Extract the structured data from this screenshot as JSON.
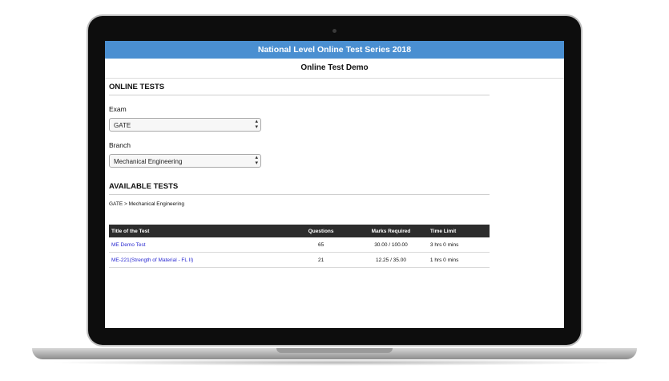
{
  "header": {
    "title": "National Level Online Test Series 2018"
  },
  "subheader": {
    "title": "Online Test Demo"
  },
  "online_tests": {
    "heading": "ONLINE TESTS",
    "exam_label": "Exam",
    "exam_value": "GATE",
    "branch_label": "Branch",
    "branch_value": "Mechanical Engineering"
  },
  "available_tests": {
    "heading": "AVAILABLE TESTS",
    "breadcrumb": "GATE > Mechanical Engineering",
    "columns": [
      "Title of the Test",
      "Questions",
      "Marks Required",
      "Time Limit"
    ],
    "rows": [
      {
        "title": "ME Demo Test",
        "questions": "65",
        "marks": "30.00 / 100.00",
        "time": "3 hrs 0 mins"
      },
      {
        "title": "ME-221(Strength of Material - FL II)",
        "questions": "21",
        "marks": "12.25 / 35.00",
        "time": "1 hrs 0 mins"
      }
    ]
  },
  "colors": {
    "topbar": "#4a8fd1",
    "table_header": "#2c2c2c",
    "link": "#2a2ad1"
  },
  "icons": {
    "select_arrow": "select-arrows-icon",
    "camera": "webcam-icon"
  }
}
